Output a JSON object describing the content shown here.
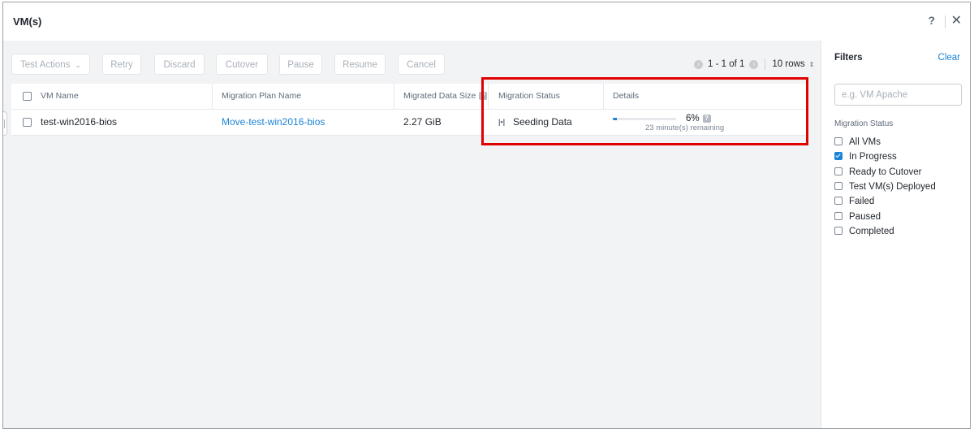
{
  "window": {
    "title": "VM(s)",
    "help": "?",
    "close": "✕"
  },
  "toolbar": {
    "buttons": [
      "Test Actions",
      "Retry",
      "Discard",
      "Cutover",
      "Pause",
      "Resume",
      "Cancel"
    ],
    "chevron": "⌄"
  },
  "pagination": {
    "range": "1 - 1 of 1",
    "rows": "10 rows",
    "prev": "‹",
    "next": "›",
    "sort": "⇕"
  },
  "table": {
    "headers": [
      "VM Name",
      "Migration Plan Name",
      "Migrated Data Size",
      "Migration Status",
      "Details"
    ],
    "help_mark": "?",
    "rows": [
      {
        "vm_name": "test-win2016-bios",
        "plan_name": "Move-test-win2016-bios",
        "data_size": "2.27 GiB",
        "status_icon": "|•|",
        "status": "Seeding Data",
        "progress_percent": 6,
        "progress_label": "6%",
        "remaining": "23 minute(s) remaining"
      }
    ]
  },
  "filters": {
    "title": "Filters",
    "clear": "Clear",
    "search_placeholder": "e.g. VM Apache",
    "section_label": "Migration Status",
    "options": [
      {
        "label": "All VMs",
        "checked": false
      },
      {
        "label": "In Progress",
        "checked": true
      },
      {
        "label": "Ready to Cutover",
        "checked": false
      },
      {
        "label": "Test VM(s) Deployed",
        "checked": false
      },
      {
        "label": "Failed",
        "checked": false
      },
      {
        "label": "Paused",
        "checked": false
      },
      {
        "label": "Completed",
        "checked": false
      }
    ]
  },
  "colors": {
    "accent": "#1b83d6",
    "highlight": "#e00000"
  }
}
